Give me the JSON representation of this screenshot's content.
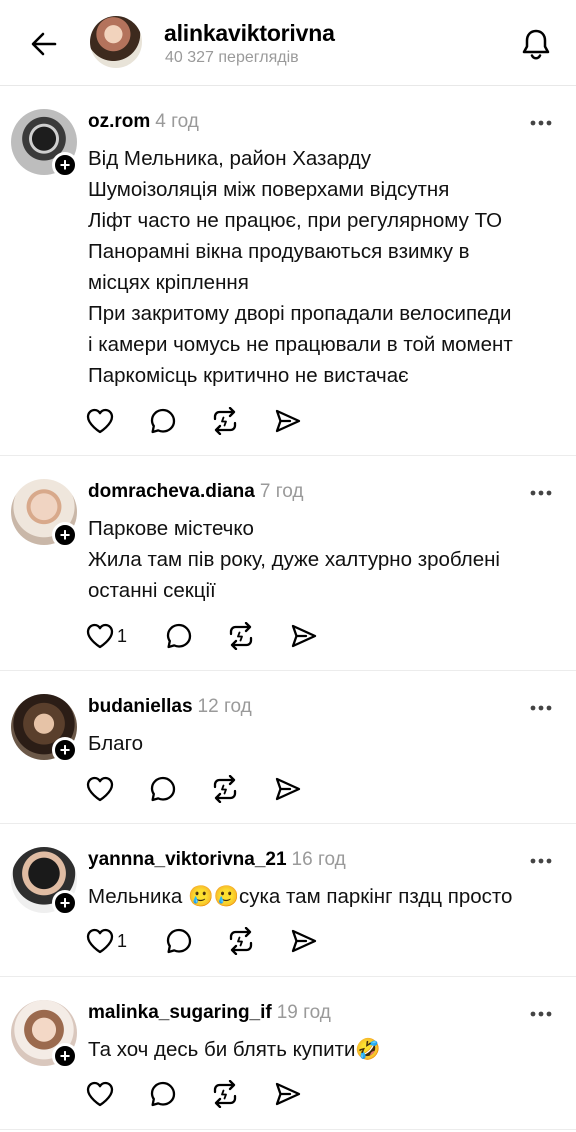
{
  "header": {
    "title": "alinkaviktorivna",
    "subtitle": "40 327 переглядів"
  },
  "comments": [
    {
      "username": "oz.rom",
      "time": "4 год",
      "lines": [
        "Від Мельника, район Хазарду",
        "Шумоізоляція між поверхами відсутня",
        "Ліфт часто не працює, при регулярному ТО",
        "Панорамні вікна продуваються взимку в",
        "місцях кріплення",
        "При закритому дворі пропадали велосипеди",
        "і камери чомусь не працювали в той момент",
        "Паркомісць критично не вистачає"
      ],
      "likes": ""
    },
    {
      "username": "domracheva.diana",
      "time": "7 год",
      "lines": [
        "Паркове містечко",
        "Жила там пів року, дуже халтурно зроблені",
        "останні секції"
      ],
      "likes": "1"
    },
    {
      "username": "budaniellas",
      "time": "12 год",
      "lines": [
        "Благо"
      ],
      "likes": ""
    },
    {
      "username": "yannna_viktorivna_21",
      "time": "16 год",
      "lines": [
        "Мельника 🥲🥲сука там паркінг пздц просто"
      ],
      "likes": "1"
    },
    {
      "username": "malinka_sugaring_if",
      "time": "19 год",
      "lines": [
        "Та хоч десь би блять купити🤣"
      ],
      "likes": ""
    }
  ],
  "icons": {
    "back": "back-arrow-icon",
    "bell": "bell-icon",
    "more": "more-dots-icon",
    "like": "heart-icon",
    "reply": "comment-bubble-icon",
    "repost": "repost-icon",
    "share": "send-icon",
    "follow": "plus-icon"
  },
  "colors": {
    "text": "#000000",
    "muted": "#9a9a9a",
    "divider": "#ececec"
  }
}
